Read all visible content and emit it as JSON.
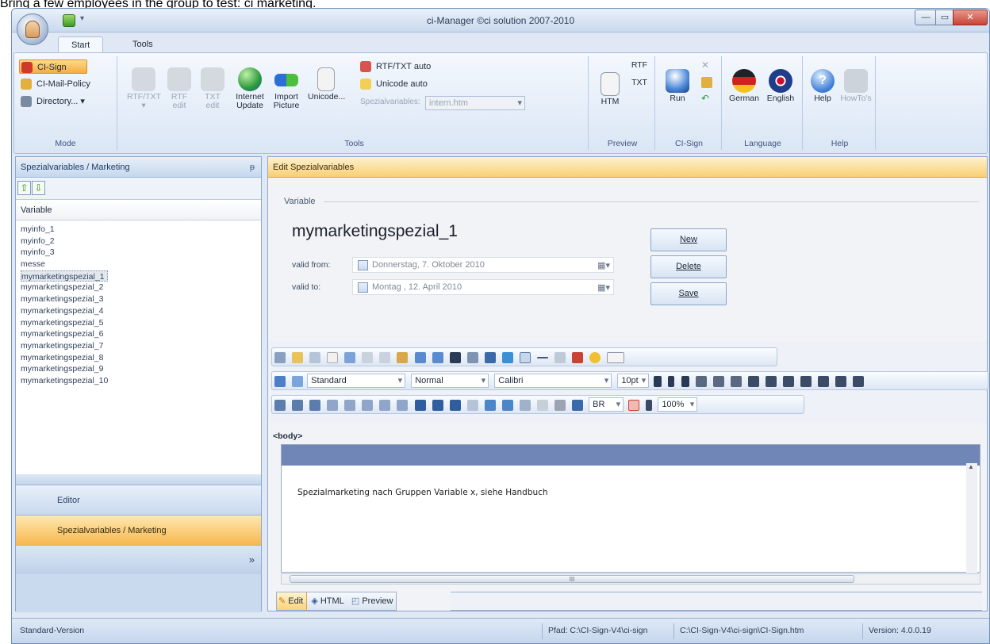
{
  "caption": "Bring a few employees in the group to test: ci marketing.",
  "window": {
    "title": "ci-Manager ©ci solution 2007-2010",
    "min": "—",
    "max": "▭",
    "close": "✕",
    "close_color": "#c94335"
  },
  "tabs": [
    "Start",
    "Tools"
  ],
  "ribbon": {
    "mode": {
      "label": "Mode",
      "items": [
        {
          "label": "CI-Sign",
          "icon": "ci-sign-icon"
        },
        {
          "label": "CI-Mail-Policy",
          "icon": "mail-policy-icon"
        },
        {
          "label": "Directory... ▾",
          "icon": "directory-icon"
        }
      ]
    },
    "tools": {
      "label": "Tools",
      "buttons": [
        {
          "label": "RTF/TXT ▾",
          "icon": "rtf-txt-icon",
          "enabled": false
        },
        {
          "label": "RTF edit",
          "icon": "rtf-edit-icon",
          "enabled": false
        },
        {
          "label": "TXT edit",
          "icon": "txt-edit-icon",
          "enabled": false
        },
        {
          "label": "Internet Update",
          "icon": "globe-icon",
          "enabled": true
        },
        {
          "label": "Import Picture",
          "icon": "import-picture-icon",
          "enabled": true
        },
        {
          "label": "Unicode...",
          "icon": "unicode-icon",
          "enabled": true
        }
      ],
      "rtf_auto": "RTF/TXT auto",
      "unicode_auto": "Unicode auto",
      "spezial_label": "Spezialvariables:",
      "spezial_value": "intern.htm"
    },
    "preview": {
      "label": "Preview",
      "htm": "HTM",
      "rtf": "RTF",
      "txt": "TXT"
    },
    "cisign": {
      "label": "CI-Sign",
      "run": "Run"
    },
    "language": {
      "label": "Language",
      "german": "German",
      "english": "English"
    },
    "help": {
      "label": "Help",
      "help": "Help",
      "howto": "HowTo's"
    }
  },
  "left_panel": {
    "title": "Spezialvariables / Marketing",
    "pin": "ᵽ",
    "up": "⇧",
    "down": "⇩",
    "column": "Variable",
    "items": [
      "myinfo_1",
      "myinfo_2",
      "myinfo_3",
      "messe",
      "mymarketingspezial_1",
      "mymarketingspezial_2",
      "mymarketingspezial_3",
      "mymarketingspezial_4",
      "mymarketingspezial_5",
      "mymarketingspezial_6",
      "mymarketingspezial_7",
      "mymarketingspezial_8",
      "mymarketingspezial_9",
      "mymarketingspezial_10"
    ],
    "selected": 4,
    "nav": [
      "Editor",
      "Spezialvariables / Marketing"
    ],
    "nav_selected": 1,
    "chevron": "»"
  },
  "right_panel": {
    "title": "Edit Spezialvariables",
    "fieldset": "Variable",
    "name": "mymarketingspezial_1",
    "valid_from_label": "valid from:",
    "valid_from": "Donnerstag,  7.  Oktober   2010",
    "valid_to_label": "valid to:",
    "valid_to": "Montag  , 12.   April    2010",
    "buttons": [
      "New",
      "Delete",
      "Save"
    ],
    "style_combo": "Standard",
    "format_combo": "Normal",
    "font_combo": "Calibri",
    "size_combo": "10pt",
    "br_combo": "BR",
    "zoom_combo": "100%",
    "body_tag": "<body>",
    "content": "Spezialmarketing nach Gruppen Variable x, siehe Handbuch",
    "scroll_grip": "III",
    "mode_tabs": [
      "Edit",
      "HTML",
      "Preview"
    ]
  },
  "status": {
    "left": "Standard-Version",
    "path1": "Pfad: C:\\CI-Sign-V4\\ci-sign",
    "path2": "C:\\CI-Sign-V4\\ci-sign\\CI-Sign.htm",
    "version": "Version: 4.0.0.19"
  }
}
